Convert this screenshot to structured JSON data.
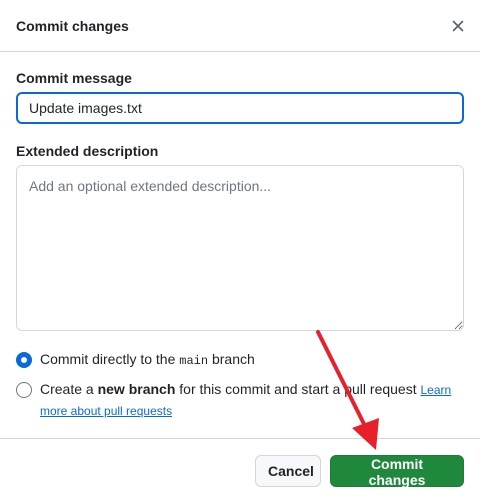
{
  "dialog": {
    "title": "Commit changes",
    "close_icon": "close-icon"
  },
  "commit_message": {
    "label": "Commit message",
    "value": "Update images.txt"
  },
  "extended_description": {
    "label": "Extended description",
    "placeholder": "Add an optional extended description..."
  },
  "branch_options": {
    "direct": {
      "text_before": "Commit directly to the ",
      "branch_name": "main",
      "text_after": " branch",
      "selected": true
    },
    "new_branch": {
      "text_before": "Create a ",
      "bold_text": "new branch",
      "text_after": " for this commit and start a pull request ",
      "link_text": "Learn more about pull requests",
      "selected": false
    }
  },
  "footer": {
    "cancel_label": "Cancel",
    "commit_label": "Commit changes"
  },
  "colors": {
    "accent": "#0969da",
    "primary_button": "#1f883d",
    "annotation_arrow": "#e8202a"
  }
}
